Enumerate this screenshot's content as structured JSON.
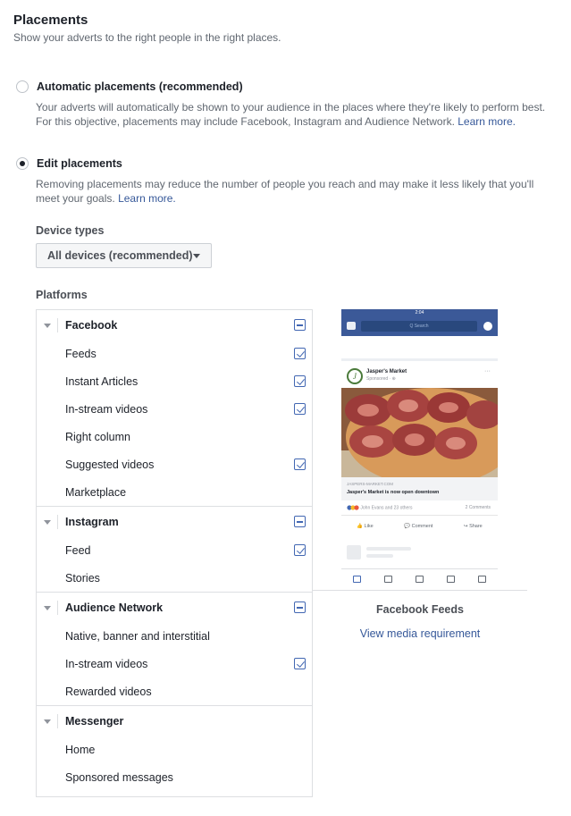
{
  "header": {
    "title": "Placements",
    "subtitle": "Show your adverts to the right people in the right places."
  },
  "placement_options": [
    {
      "label": "Automatic placements (recommended)",
      "selected": false,
      "description": "Your adverts will automatically be shown to your audience in the places where they're likely to perform best. For this objective, placements may include Facebook, Instagram and Audience Network.",
      "link": "Learn more."
    },
    {
      "label": "Edit placements",
      "selected": true,
      "description": "Removing placements may reduce the number of people you reach and may make it less likely that you'll meet your goals.",
      "link": "Learn more."
    }
  ],
  "device_types": {
    "label": "Device types",
    "selected": "All devices (recommended)"
  },
  "platforms": {
    "label": "Platforms",
    "groups": [
      {
        "name": "Facebook",
        "items": [
          {
            "label": "Feeds",
            "checked": true
          },
          {
            "label": "Instant Articles",
            "checked": true
          },
          {
            "label": "In-stream videos",
            "checked": true
          },
          {
            "label": "Right column",
            "checked": false
          },
          {
            "label": "Suggested videos",
            "checked": true
          },
          {
            "label": "Marketplace",
            "checked": false
          }
        ]
      },
      {
        "name": "Instagram",
        "items": [
          {
            "label": "Feed",
            "checked": true
          },
          {
            "label": "Stories",
            "checked": false
          }
        ]
      },
      {
        "name": "Audience Network",
        "items": [
          {
            "label": "Native, banner and interstitial",
            "checked": false
          },
          {
            "label": "In-stream videos",
            "checked": true
          },
          {
            "label": "Rewarded videos",
            "checked": false
          }
        ]
      },
      {
        "name": "Messenger",
        "items": [
          {
            "label": "Home",
            "checked": false
          },
          {
            "label": "Sponsored messages",
            "checked": false
          }
        ]
      }
    ]
  },
  "preview": {
    "status_time": "2:04",
    "search_placeholder": "Q  Search",
    "post_name": "Jasper's Market",
    "post_sponsored": "Sponsored · ⊕",
    "avatar_letter": "J",
    "link_url": "JASPERS-MARKET.COM",
    "link_title": "Jasper's Market is now open downtown",
    "reactions_text": "John Evans and 23 others",
    "comments_text": "2 Comments",
    "action_like": "Like",
    "action_comment": "Comment",
    "action_share": "Share",
    "caption": "Facebook Feeds",
    "media_link": "View media requirement"
  },
  "colors": {
    "accent": "#4267b2",
    "link": "#365899",
    "fb_blue": "#3b5998"
  }
}
